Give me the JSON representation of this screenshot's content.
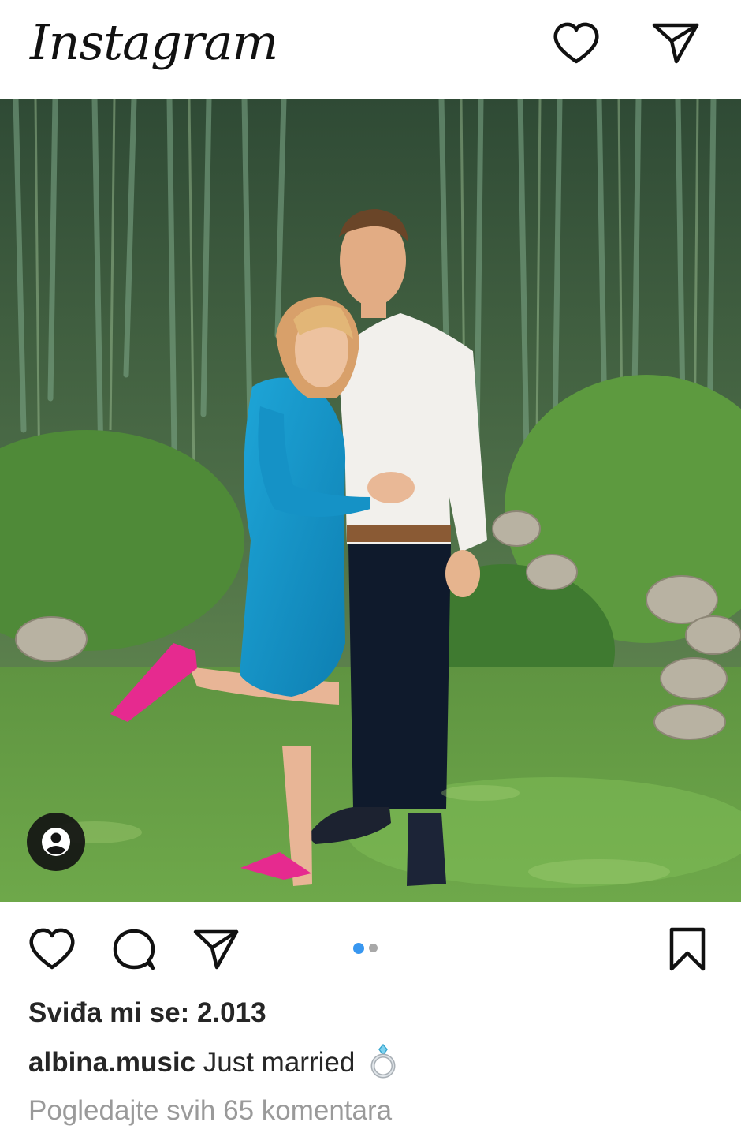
{
  "header": {
    "logo_text": "Instagram",
    "icons": [
      "heart-icon",
      "paper-plane-icon"
    ]
  },
  "post": {
    "carousel": {
      "current": 1,
      "total": 2,
      "active_color": "#3897f0",
      "inactive_color": "#a8a8a8"
    },
    "tag_icon": "user-tag-icon",
    "likes_text": "Sviđa mi se: 2.013",
    "caption": {
      "username": "albina.music",
      "text": "Just married",
      "emoji_icon": "ring-icon"
    },
    "view_comments_text": "Pogledajte svih 65 komentara"
  },
  "actions": {
    "icons": [
      "heart-icon",
      "comment-icon",
      "share-icon",
      "bookmark-icon"
    ]
  }
}
